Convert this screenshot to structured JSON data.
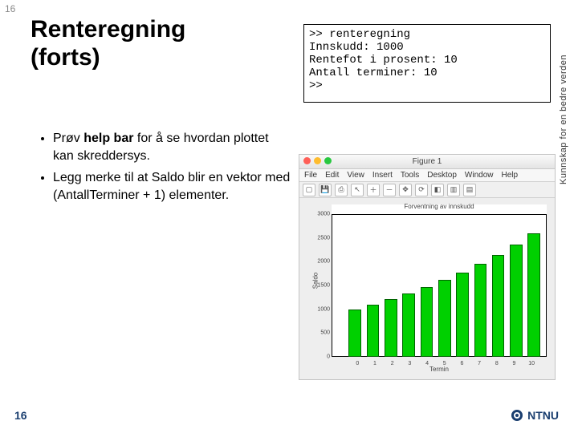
{
  "page": {
    "num_top": "16",
    "num_bottom": "16"
  },
  "title": {
    "line1": "Renteregning",
    "line2": "(forts)"
  },
  "sidebar": "Kunnskap for en bedre verden",
  "bullets": {
    "items": [
      {
        "pre": "Prøv ",
        "bold": "help bar",
        "post": " for å se hvordan plottet kan skreddersys."
      },
      {
        "pre": "Legg merke til at Saldo blir en vektor med (AntallTerminer + 1) elementer.",
        "bold": "",
        "post": ""
      }
    ]
  },
  "console": {
    "line1": ">> renteregning",
    "line2": "Innskudd: 1000",
    "line3": "Rentefot i prosent: 10",
    "line4": "Antall terminer: 10",
    "line5": ">>"
  },
  "figure": {
    "window_title": "Figure 1",
    "menus": [
      "File",
      "Edit",
      "View",
      "Insert",
      "Tools",
      "Desktop",
      "Window",
      "Help"
    ]
  },
  "chart_data": {
    "type": "bar",
    "title": "Forventning av innskudd",
    "xlabel": "Termin",
    "ylabel": "Saldo",
    "categories": [
      "0",
      "1",
      "2",
      "3",
      "4",
      "5",
      "6",
      "7",
      "8",
      "9",
      "10"
    ],
    "values": [
      1000,
      1100,
      1210,
      1331,
      1464,
      1611,
      1772,
      1949,
      2144,
      2358,
      2594
    ],
    "ylim": [
      0,
      3000
    ],
    "yticks": [
      "0",
      "500",
      "1000",
      "1500",
      "2000",
      "2500",
      "3000"
    ]
  },
  "brand": {
    "name": "NTNU"
  }
}
